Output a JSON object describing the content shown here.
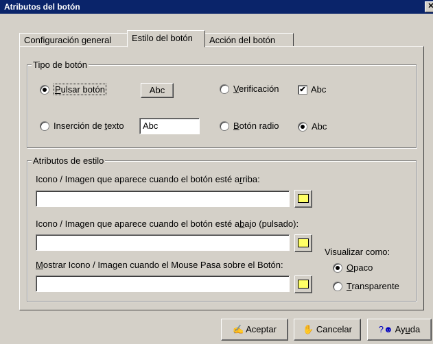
{
  "window": {
    "title": "Atributos del botón",
    "close_glyph": "✕"
  },
  "tabs": [
    {
      "label": "Configuración general"
    },
    {
      "label": "Estilo del botón"
    },
    {
      "label": "Acción del botón"
    }
  ],
  "tipo_group": {
    "label": "Tipo de botón",
    "pulsar": {
      "label_before": "",
      "accel": "P",
      "label_after": "ulsar botón",
      "checked": true
    },
    "pulsar_sample": "Abc",
    "verificacion": {
      "accel": "V",
      "label_after": "erificación",
      "checked": false
    },
    "verificacion_sample": "Abc",
    "insercion": {
      "label_before": "Inserción de ",
      "accel": "t",
      "label_after": "exto",
      "checked": false
    },
    "insercion_sample": "Abc",
    "radio": {
      "accel": "B",
      "label_after": "otón radio",
      "checked": false
    },
    "radio_sample": "Abc"
  },
  "estilo_group": {
    "label": "Atributos de estilo",
    "arriba": {
      "before": "Icono / Imagen que aparece cuando el botón esté a",
      "accel": "r",
      "after": "riba:",
      "value": ""
    },
    "abajo": {
      "before": "Icono / Imagen que aparece cuando el botón esté a",
      "accel": "b",
      "after": "ajo (pulsado):",
      "value": ""
    },
    "mouse": {
      "before": "",
      "accel": "M",
      "after": "ostrar Icono / Imagen cuando el Mouse Pasa sobre el Botón:",
      "value": ""
    },
    "visualizar_label": "Visualizar como:",
    "opaco": {
      "accel": "O",
      "after": "paco",
      "checked": true
    },
    "transparente": {
      "accel": "T",
      "after": "ransparente",
      "checked": false
    }
  },
  "footer": {
    "accept": "Aceptar",
    "cancel": "Cancelar",
    "help_accel": "u",
    "help_before": "Ay",
    "help_after": "da"
  }
}
